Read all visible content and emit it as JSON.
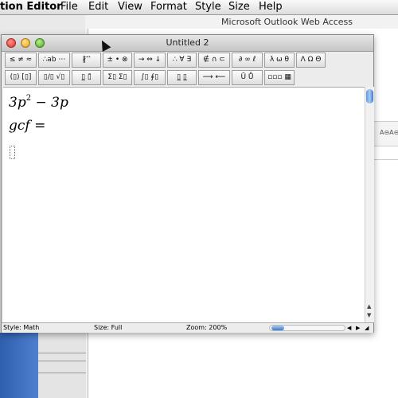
{
  "menubar": {
    "app": "tion Editor",
    "items": [
      "File",
      "Edit",
      "View",
      "Format",
      "Style",
      "Size",
      "Help"
    ]
  },
  "background_window": {
    "title": "Microsoft Outlook Web Access",
    "right_icons": "A⊖A⊖"
  },
  "window": {
    "title": "Untitled 2"
  },
  "toolbar": {
    "row1": [
      "≤ ≠ ≈",
      "∴ab ⋯",
      "∦ ⃗ ⃗",
      "± • ⊗",
      "→ ⇔ ↓",
      "∴ ∀ ∃",
      "∉ ∩ ⊂",
      "∂ ∞ ℓ",
      "λ ω θ",
      "Λ Ω Θ"
    ],
    "row2": [
      "(▯) [▯]",
      "▯/▯ √▯",
      "▯̲ ▯̄",
      "Σ▯ Σ▯",
      "∫▯ ∮▯",
      "▯̲ ▯̲",
      "⟶ ⟵",
      "Ū Ů",
      "▫▫▫ ▦"
    ]
  },
  "editor": {
    "line1": {
      "a": "3p",
      "exp": "2",
      "b": " − 3p"
    },
    "line2": "gcf ="
  },
  "status": {
    "style": "Style: Math",
    "size": "Size: Full",
    "zoom": "Zoom: 200%"
  }
}
